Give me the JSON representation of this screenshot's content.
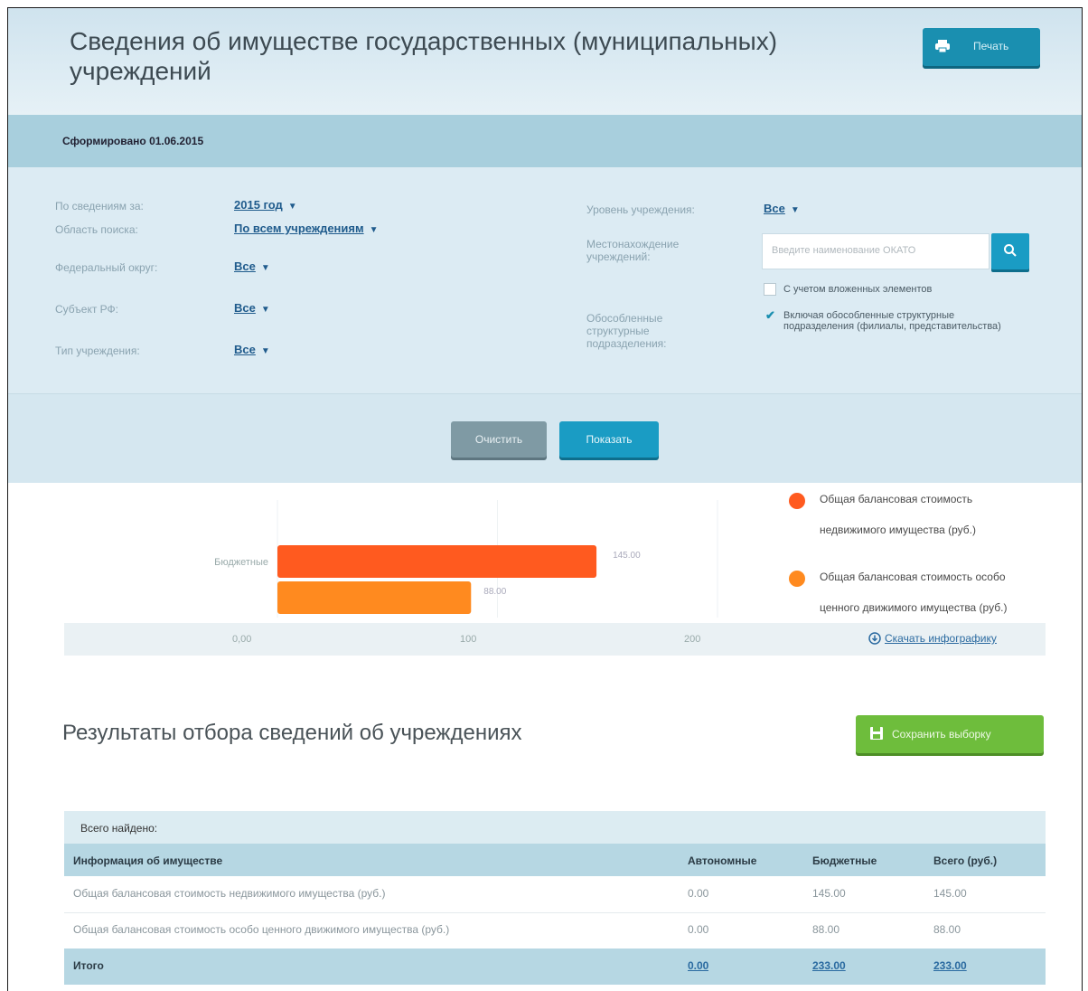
{
  "header": {
    "title": "Сведения об имуществе государственных (муниципальных) учреждений",
    "print_label": "Печать"
  },
  "formed": {
    "text": "Сформировано 01.06.2015"
  },
  "filters": {
    "period_label": "По сведениям за:",
    "period_value": "2015 год",
    "scope_label": "Область поиска:",
    "scope_value": "По всем учреждениям",
    "district_label": "Федеральный округ:",
    "district_value": "Все",
    "subject_label": "Субъект РФ:",
    "subject_value": "Все",
    "type_label": "Тип учреждения:",
    "type_value": "Все",
    "level_label": "Уровень учреждения:",
    "level_value": "Все",
    "location_label": "Местонахождение учреждений:",
    "okato_placeholder": "Введите наименование ОКАТО",
    "nested_label": "С учетом вложенных элементов",
    "separate_label": "Обособленные структурные подразделения:",
    "separate_option": "Включая обособленные структурные подразделения (филиалы, представительства)"
  },
  "actions": {
    "clear_label": "Очистить",
    "show_label": "Показать"
  },
  "chart_data": {
    "type": "bar",
    "orientation": "horizontal",
    "categories": [
      "Бюджетные"
    ],
    "series": [
      {
        "name": "Общая балансовая стоимость недвижимого имущества (руб.)",
        "values": [
          145.0
        ],
        "label": "145.00",
        "color": "#ff5a1f"
      },
      {
        "name": "Общая балансовая стоимость особо ценного движимого имущества (руб.)",
        "values": [
          88.0
        ],
        "label": "88.00",
        "color": "#ff8a1f"
      }
    ],
    "xticks": [
      "0,00",
      "100",
      "200"
    ],
    "xlim": [
      0,
      200
    ]
  },
  "chart_link": "Скачать инфографику",
  "results": {
    "title": "Результаты отбора сведений об учреждениях",
    "save_label": "Сохранить выборку"
  },
  "table": {
    "found_label": "Всего найдено:",
    "headers": [
      "Информация об имуществе",
      "Автономные",
      "Бюджетные",
      "Всего (руб.)"
    ],
    "rows": [
      [
        "Общая балансовая стоимость недвижимого имущества (руб.)",
        "0.00",
        "145.00",
        "145.00"
      ],
      [
        "Общая балансовая стоимость особо ценного движимого имущества (руб.)",
        "0.00",
        "88.00",
        "88.00"
      ]
    ],
    "total": [
      "Итого",
      "0.00",
      "233.00",
      "233.00"
    ]
  }
}
